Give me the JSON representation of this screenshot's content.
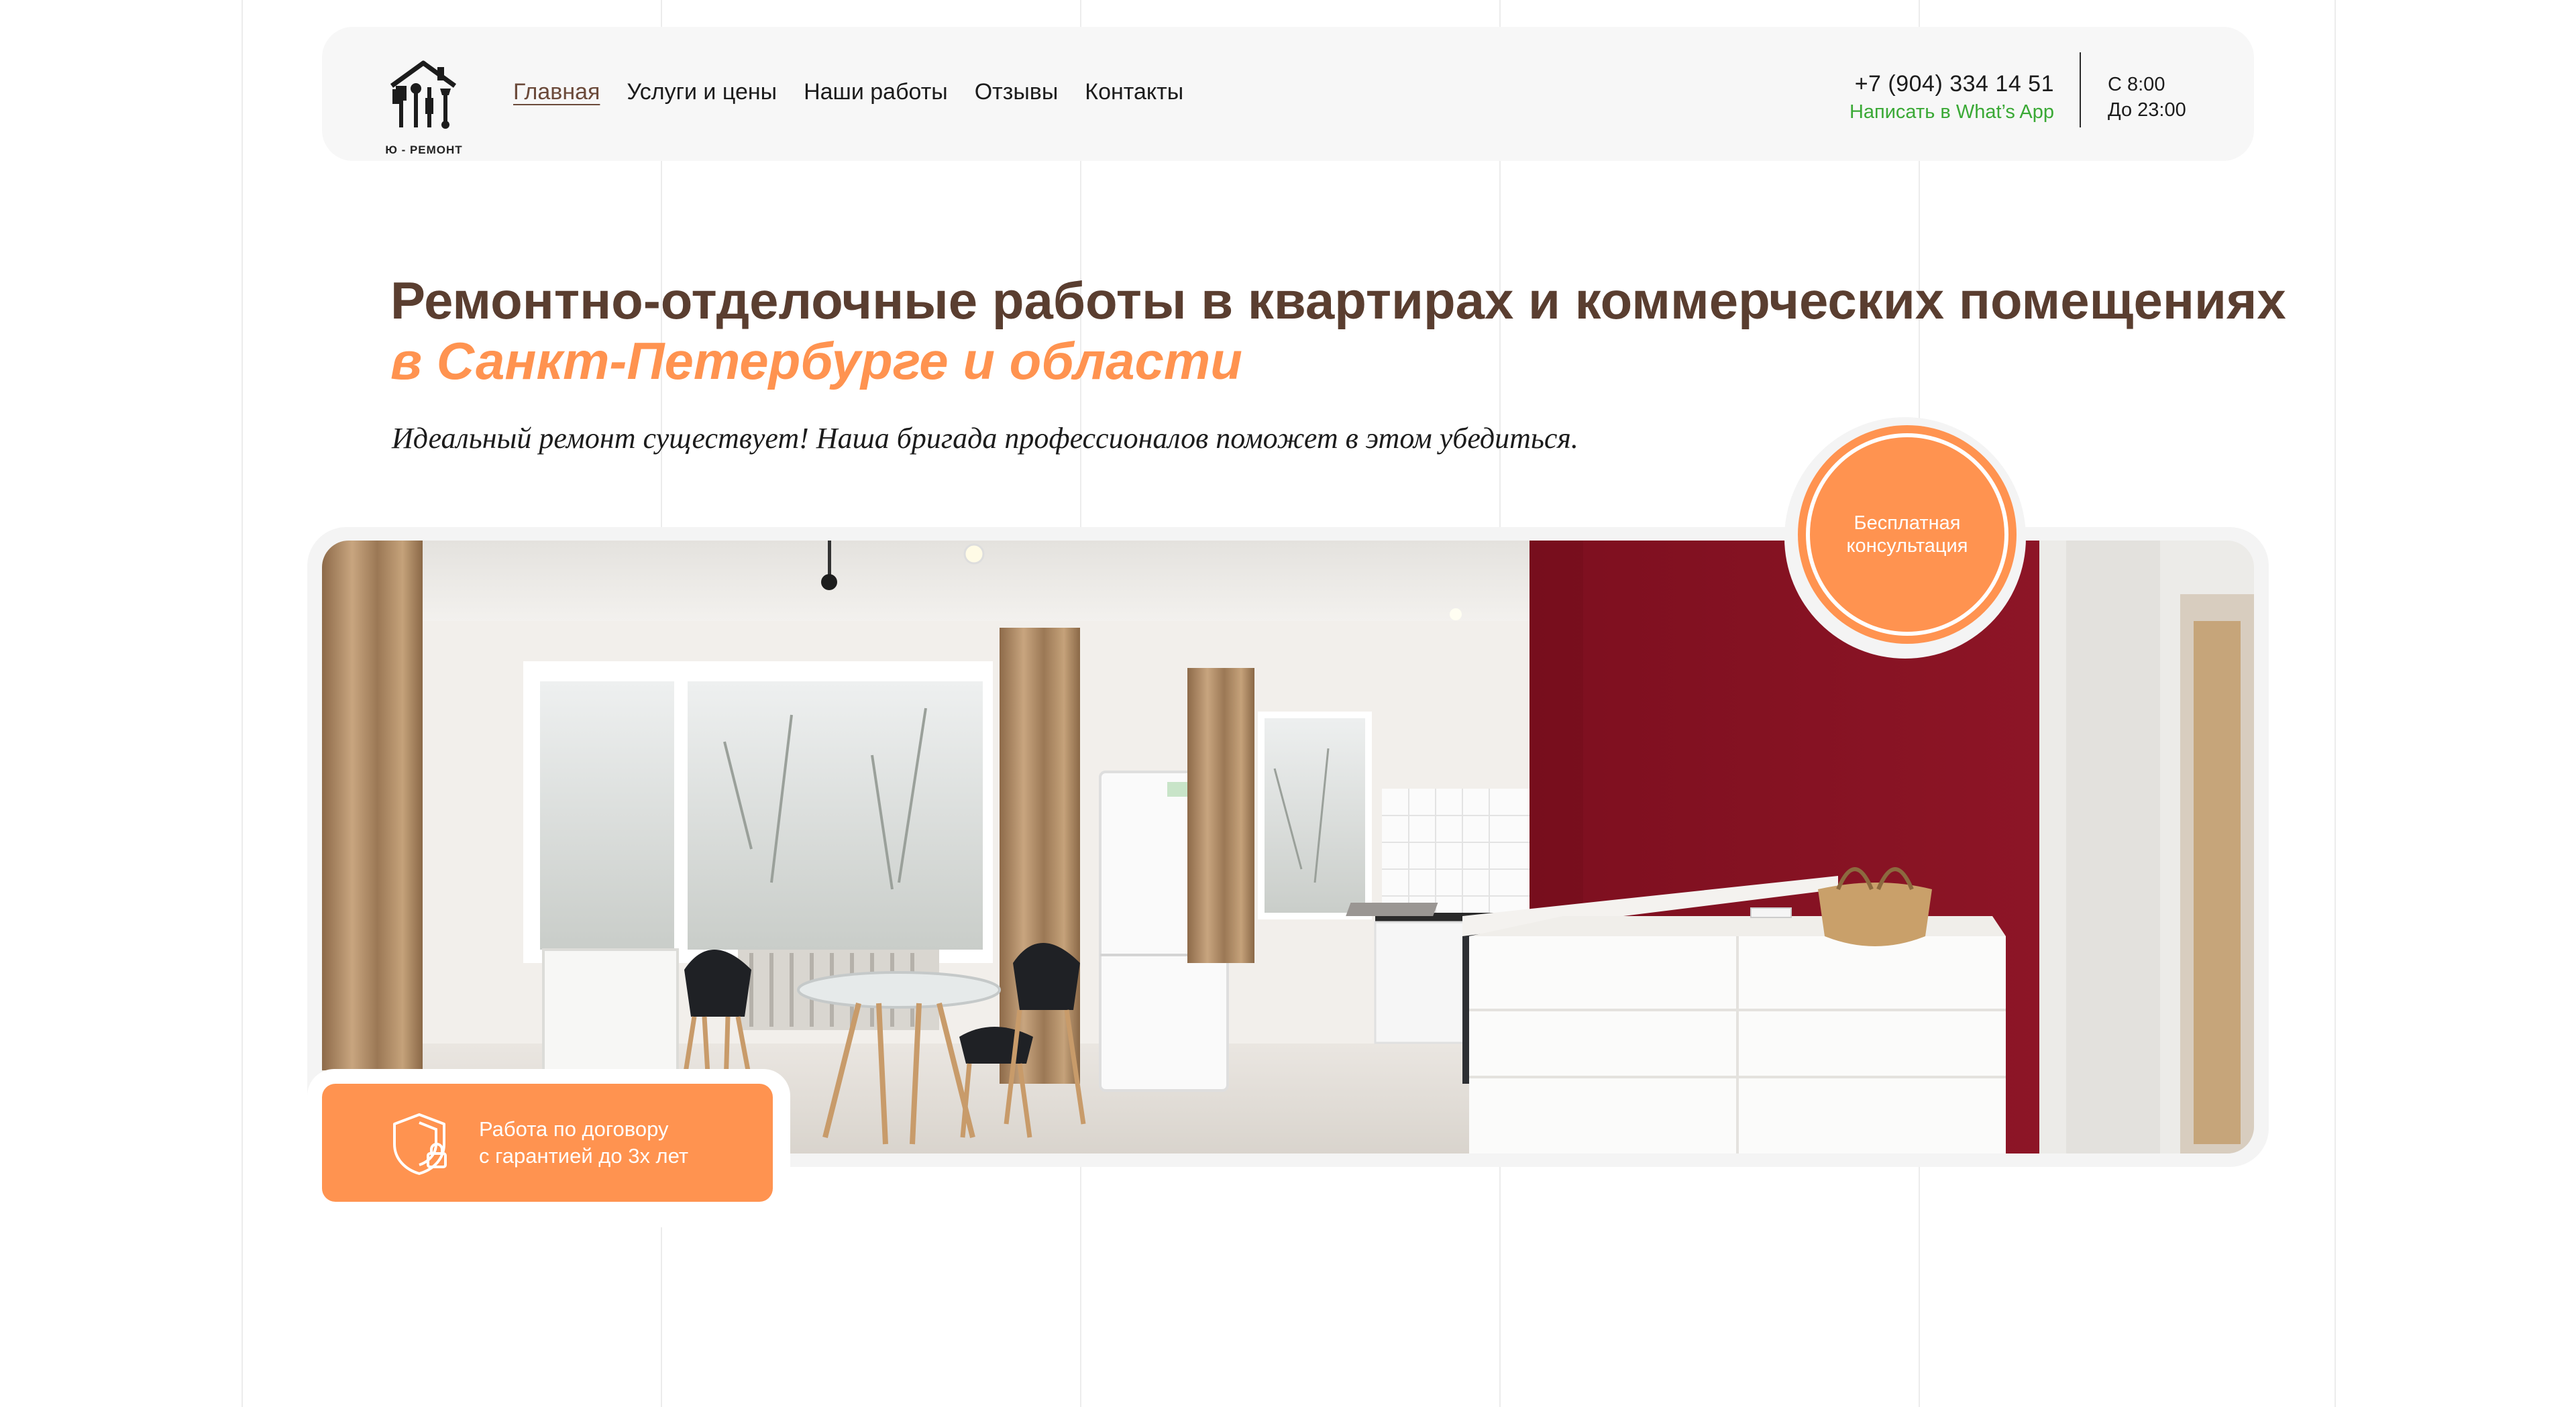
{
  "brand": {
    "logo_text": "Ю - РЕМОНТ"
  },
  "nav": [
    {
      "label": "Главная",
      "active": true
    },
    {
      "label": "Услуги и цены",
      "active": false
    },
    {
      "label": "Наши работы",
      "active": false
    },
    {
      "label": "Отзывы",
      "active": false
    },
    {
      "label": "Контакты",
      "active": false
    }
  ],
  "contact": {
    "phone": "+7 (904) 334 14 51",
    "whatsapp_label": "Написать в What’s App",
    "hours_from": "С 8:00",
    "hours_to": "До 23:00"
  },
  "hero": {
    "title": "Ремонтно-отделочные работы в квартирах и коммерческих помещениях",
    "subtitle": "в Санкт-Петербурге и области",
    "tagline": "Идеальный ремонт существует! Наша бригада профессионалов поможет в этом убедиться."
  },
  "badge": {
    "line1": "Бесплатная",
    "line2": "консультация"
  },
  "guarantee": {
    "line1": "Работа по договору",
    "line2": "с гарантией до 3х лет"
  },
  "colors": {
    "accent": "#ff9350",
    "title": "#5a3e30",
    "whatsapp": "#3aa935",
    "header_bg": "#f7f7f7"
  },
  "icons": {
    "logo": "house-tools-logo",
    "guarantee": "shield-lock-icon"
  }
}
